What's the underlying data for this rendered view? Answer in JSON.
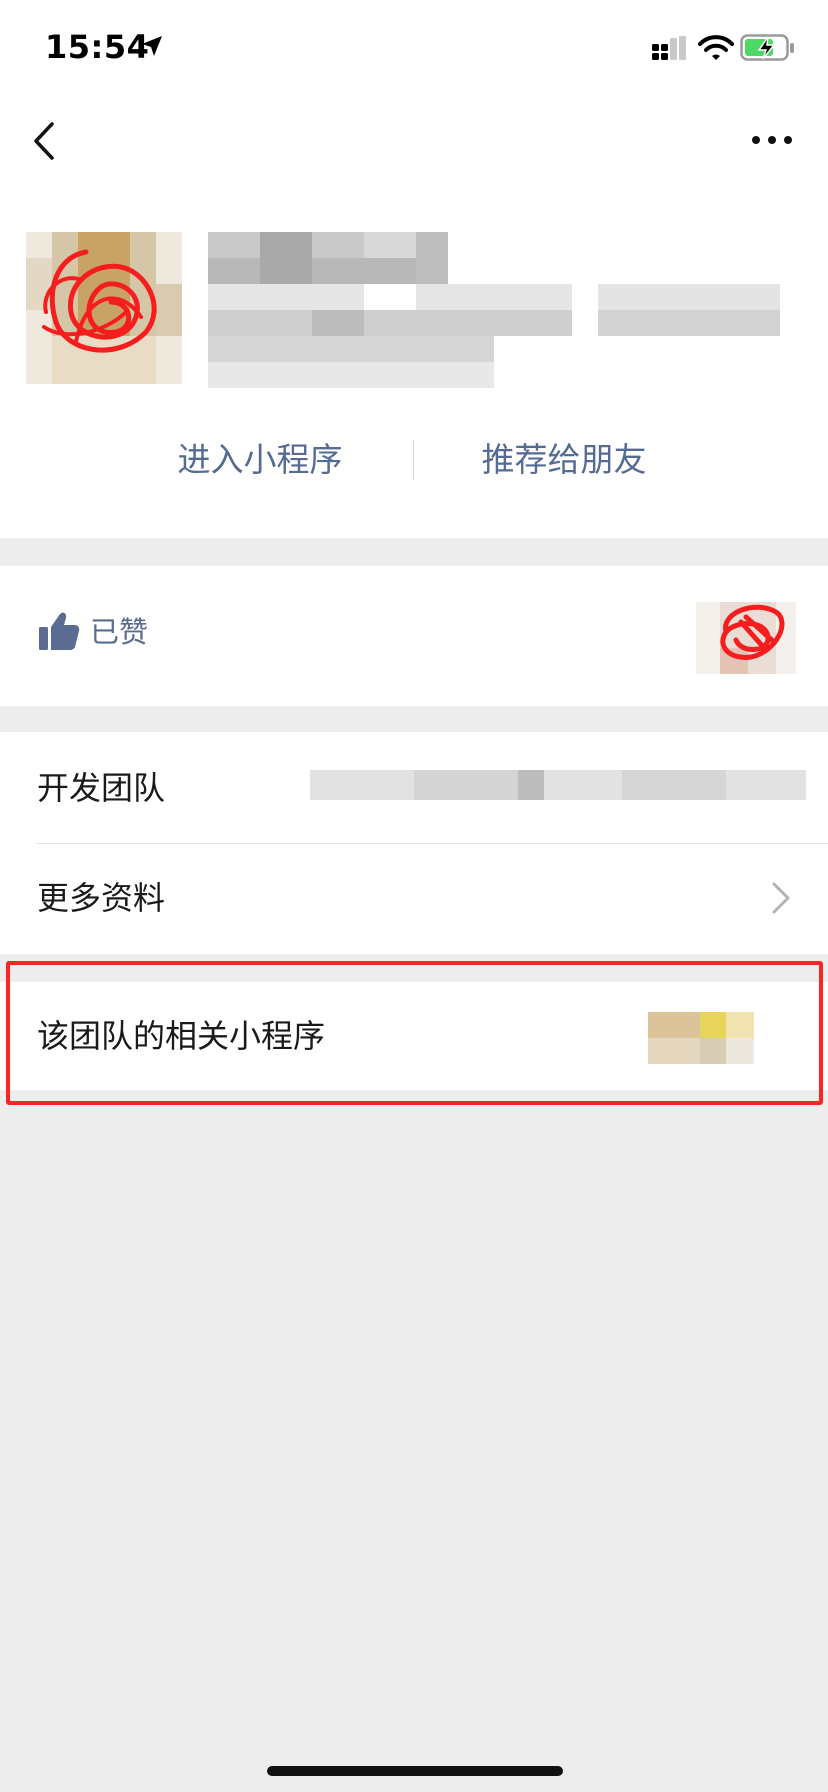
{
  "status_bar": {
    "time": "15:54"
  },
  "actions": {
    "enter_label": "进入小程序",
    "share_label": "推荐给朋友"
  },
  "like": {
    "label": "已赞"
  },
  "info": {
    "dev_team_label": "开发团队",
    "more_info_label": "更多资料"
  },
  "related": {
    "label": "该团队的相关小程序"
  },
  "colors": {
    "link": "#566b94",
    "like": "#5a6c92",
    "highlight": "#ff2424",
    "background": "#ededed"
  },
  "icons": [
    "location-arrow-icon",
    "signal-icon",
    "wifi-icon",
    "battery-charging-icon",
    "back-chevron-icon",
    "more-dots-icon",
    "thumbs-up-icon",
    "chevron-right-icon"
  ]
}
